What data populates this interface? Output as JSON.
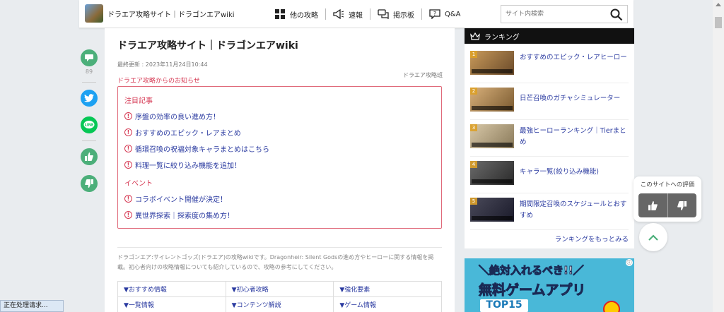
{
  "header": {
    "site_title": "ドラエア攻略サイト｜ドラゴンエアwiki",
    "nav": [
      {
        "label": "他の攻略",
        "icon": "grid-icon"
      },
      {
        "label": "速報",
        "icon": "megaphone-icon"
      },
      {
        "label": "掲示板",
        "icon": "chat-icon"
      },
      {
        "label": "Q&A",
        "icon": "question-icon"
      }
    ],
    "search_placeholder": "サイト内検索"
  },
  "share": {
    "comment_count": "89"
  },
  "main": {
    "title": "ドラエア攻略サイト｜ドラゴンエアwiki",
    "updated": "最終更新 : 2023年11月24日10:44",
    "notice": "ドラエア攻略からのお知らせ",
    "team": "ドラエア攻略班",
    "featured_heading": "注目記事",
    "featured": [
      "序盤の効率の良い進め方！",
      "おすすめのエピック・レアまとめ",
      "循環召喚の祝福対象キャラまとめはこちら",
      "料理一覧に絞り込み機能を追加！"
    ],
    "event_heading": "イベント",
    "events": [
      "コラボイベント開催が決定！",
      "異世界探索｜探索度の集め方！"
    ],
    "description": "ドラゴンエア:サイレントゴッズ(ドラエア)の攻略wikiです。Dragonheir: Silent Godsの進め方やヒーローに関する情報を掲載。初心者向けの攻略情報についても紹介しているので、攻略の参考にしてください。",
    "links": [
      [
        "▼おすすめ情報",
        "▼初心者攻略",
        "▼強化要素"
      ],
      [
        "▼一覧情報",
        "▼コンテンツ解説",
        "▼ゲーム情報"
      ]
    ]
  },
  "ranking": {
    "heading": "ランキング",
    "items": [
      {
        "rank": "1",
        "text": "おすすめのエピック・レアヒーロー"
      },
      {
        "rank": "2",
        "text": "日芒召喚のガチャシミュレーター"
      },
      {
        "rank": "3",
        "text": "最強ヒーローランキング｜Tierまとめ"
      },
      {
        "rank": "4",
        "text": "キャラ一覧(絞り込み機能)"
      },
      {
        "rank": "5",
        "text": "期間限定召喚のスケジュールとおすすめ"
      }
    ],
    "more": "ランキングをもっとみる"
  },
  "ad": {
    "line1": "＼絶対入れるべき!!／",
    "line2": "無料ゲームアプリ",
    "line3": "TOP15",
    "info": "ⓘ"
  },
  "rating": {
    "label": "このサイトへの評価"
  },
  "status": "正在处理请求..."
}
